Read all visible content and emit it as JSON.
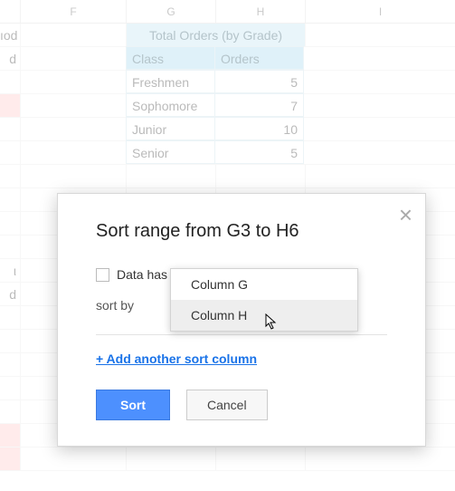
{
  "columns": {
    "E": "",
    "F": "F",
    "G": "G",
    "H": "H",
    "I": "I"
  },
  "left_fragments": {
    "r1": "ıod",
    "r2": "d",
    "r11": "ι",
    "r12": "d"
  },
  "table": {
    "title": "Total Orders (by Grade)",
    "head": {
      "class": "Class",
      "orders": "Orders"
    },
    "rows": [
      {
        "class": "Freshmen",
        "orders": "5"
      },
      {
        "class": "Sophomore",
        "orders": "7"
      },
      {
        "class": "Junior",
        "orders": "10"
      },
      {
        "class": "Senior",
        "orders": "5"
      }
    ]
  },
  "dialog": {
    "title": "Sort range from G3 to H6",
    "data_has": "Data has",
    "sort_by": "sort by",
    "add_link": "+ Add another sort column",
    "sort_btn": "Sort",
    "cancel_btn": "Cancel"
  },
  "dropdown": {
    "opt_g": "Column G",
    "opt_h": "Column H"
  }
}
